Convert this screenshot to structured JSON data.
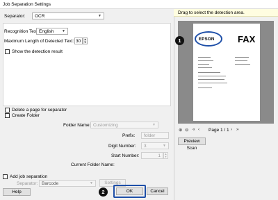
{
  "window": {
    "title": "Job Separation Settings"
  },
  "separator": {
    "label": "Separator:",
    "value": "OCR"
  },
  "recognition": {
    "label": "Recognition Text:",
    "value": "English"
  },
  "maxlen": {
    "label": "Maximum Length of Detected Text:",
    "value": "30"
  },
  "show_detection": {
    "label": "Show the detection result"
  },
  "delete_page": {
    "label": "Delete a page for separator"
  },
  "create_folder": {
    "label": "Create Folder"
  },
  "folder_name": {
    "label": "Folder Name:",
    "value": "Customizing"
  },
  "prefix": {
    "label": "Prefix:",
    "value": "folder"
  },
  "digit_number": {
    "label": "Digit Number:",
    "value": "3"
  },
  "start_number": {
    "label": "Start Number:",
    "value": "1"
  },
  "current_folder": {
    "label": "Current Folder Name:"
  },
  "add_job": {
    "label": "Add job separation"
  },
  "job_separator": {
    "label": "Separator:",
    "value": "Barcode"
  },
  "buttons": {
    "settings": "Settings",
    "help": "Help",
    "ok": "OK",
    "cancel": "Cancel"
  },
  "right": {
    "hint": "Drag to select the detection area.",
    "page_indicator": "Page 1 / 1",
    "preview_scan": "Preview Scan"
  },
  "document": {
    "logo": "EPSON",
    "heading": "FAX"
  },
  "callouts": {
    "one": "1",
    "two": "2"
  },
  "colors": {
    "accent": "#1e4fa8"
  }
}
